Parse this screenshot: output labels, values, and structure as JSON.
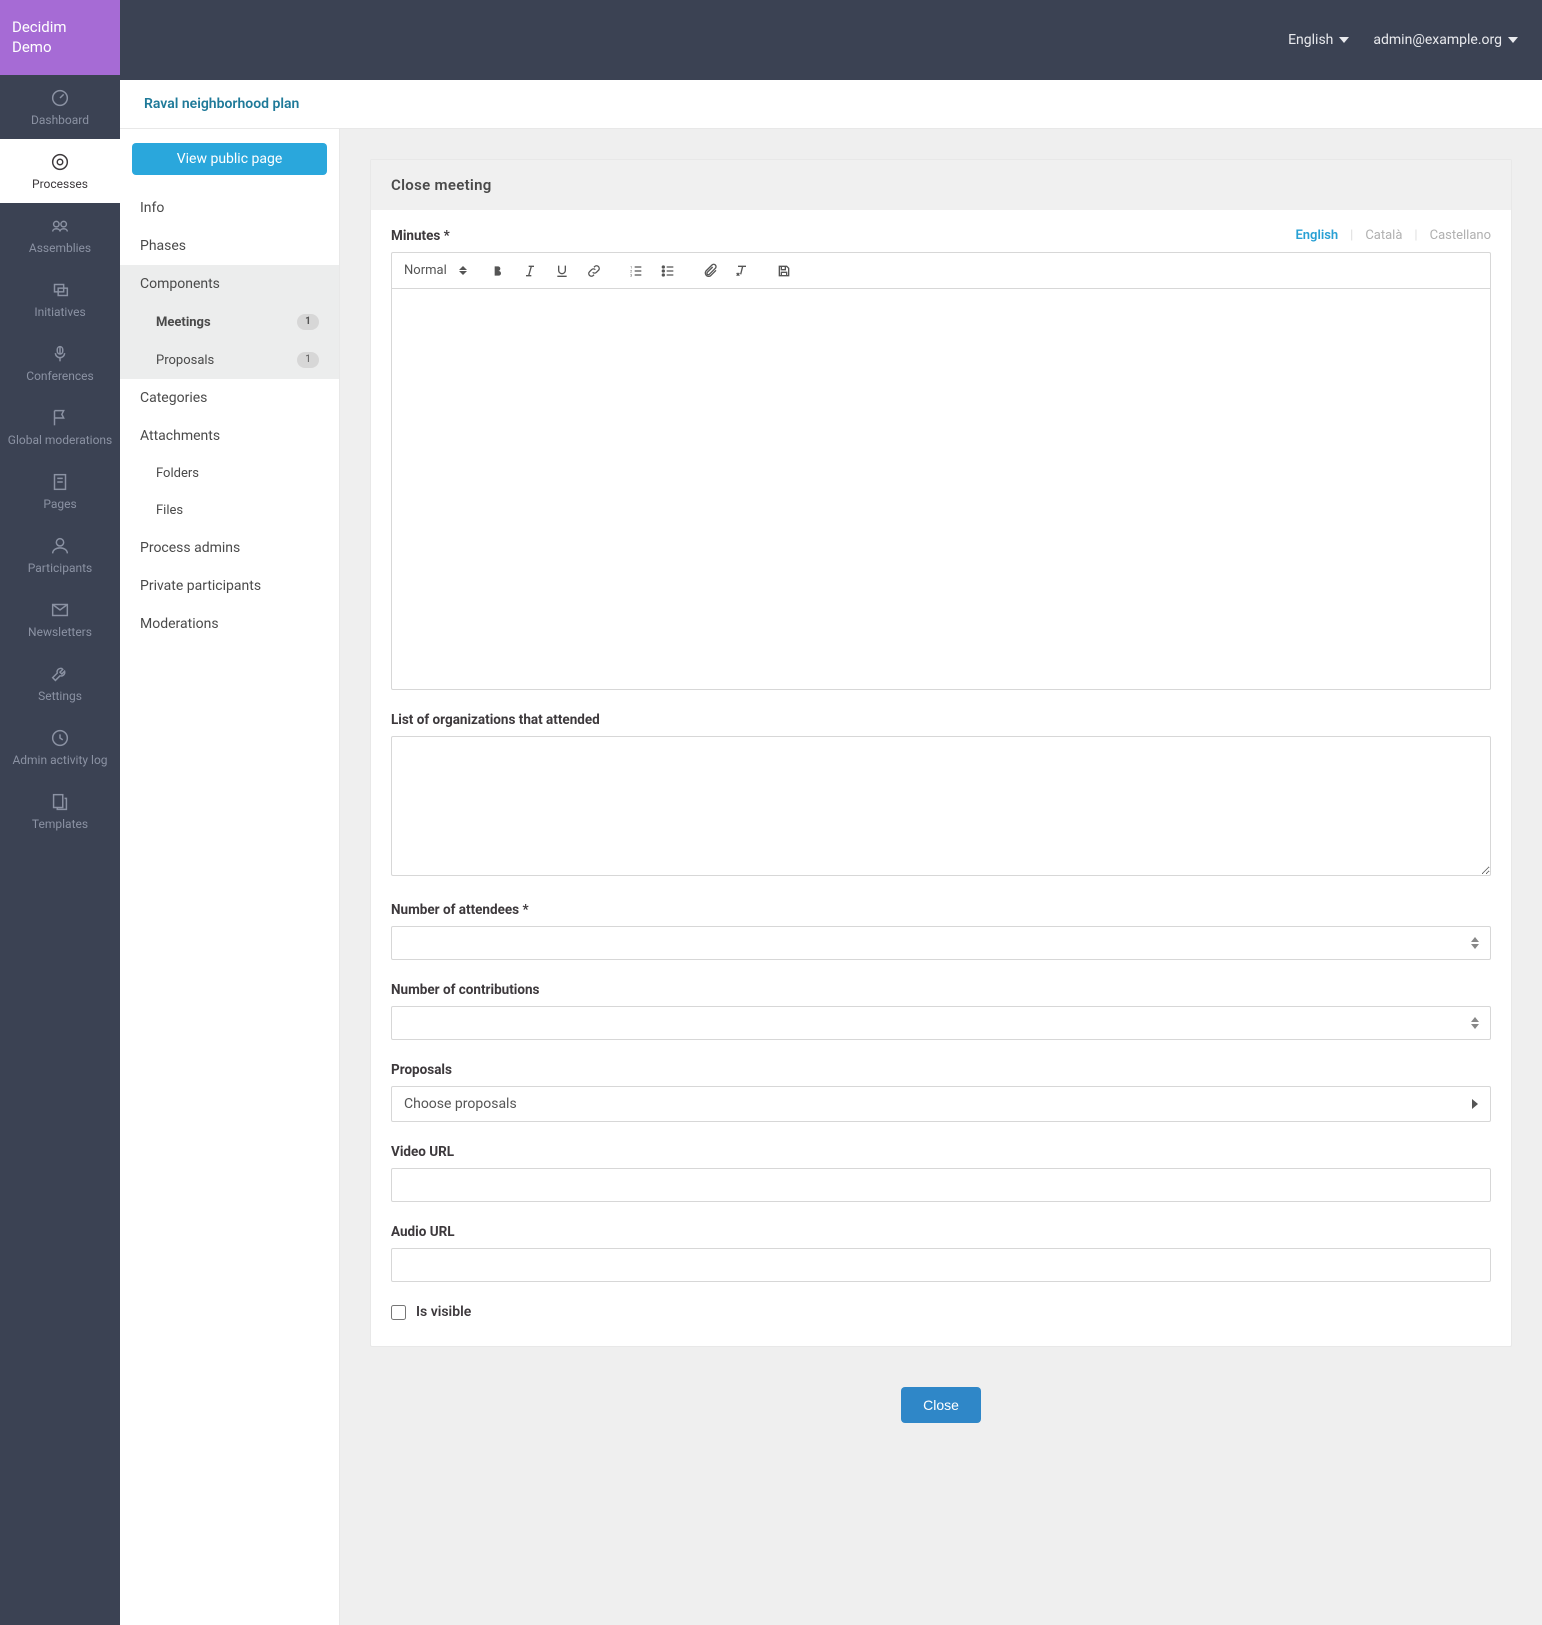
{
  "brand": "Decidim Demo",
  "topbar": {
    "language": "English",
    "user": "admin@example.org"
  },
  "titlebar": {
    "breadcrumb": "Raval neighborhood plan"
  },
  "primary_nav": {
    "items": [
      {
        "key": "dashboard",
        "label": "Dashboard"
      },
      {
        "key": "processes",
        "label": "Processes"
      },
      {
        "key": "assemblies",
        "label": "Assemblies"
      },
      {
        "key": "initiatives",
        "label": "Initiatives"
      },
      {
        "key": "conferences",
        "label": "Conferences"
      },
      {
        "key": "global-moderations",
        "label": "Global moderations"
      },
      {
        "key": "pages",
        "label": "Pages"
      },
      {
        "key": "participants",
        "label": "Participants"
      },
      {
        "key": "newsletters",
        "label": "Newsletters"
      },
      {
        "key": "settings",
        "label": "Settings"
      },
      {
        "key": "admin-activity-log",
        "label": "Admin activity log"
      },
      {
        "key": "templates",
        "label": "Templates"
      }
    ]
  },
  "secondary_nav": {
    "view_public": "View public page",
    "items": {
      "info": "Info",
      "phases": "Phases",
      "components": "Components",
      "meetings": {
        "label": "Meetings",
        "badge": "1"
      },
      "proposals": {
        "label": "Proposals",
        "badge": "1"
      },
      "categories": "Categories",
      "attachments": "Attachments",
      "folders": "Folders",
      "files": "Files",
      "process_admins": "Process admins",
      "private_participants": "Private participants",
      "moderations": "Moderations"
    }
  },
  "form": {
    "card_title": "Close meeting",
    "minutes": {
      "label": "Minutes *",
      "languages": [
        "English",
        "Català",
        "Castellano"
      ],
      "active_language": "English",
      "format_select": "Normal",
      "value": ""
    },
    "organizations": {
      "label": "List of organizations that attended",
      "value": ""
    },
    "attendees": {
      "label": "Number of attendees *",
      "value": ""
    },
    "contributions": {
      "label": "Number of contributions",
      "value": ""
    },
    "proposals": {
      "label": "Proposals",
      "placeholder": "Choose proposals"
    },
    "video_url": {
      "label": "Video URL",
      "value": ""
    },
    "audio_url": {
      "label": "Audio URL",
      "value": ""
    },
    "is_visible": {
      "label": "Is visible",
      "checked": false
    },
    "submit": "Close"
  }
}
